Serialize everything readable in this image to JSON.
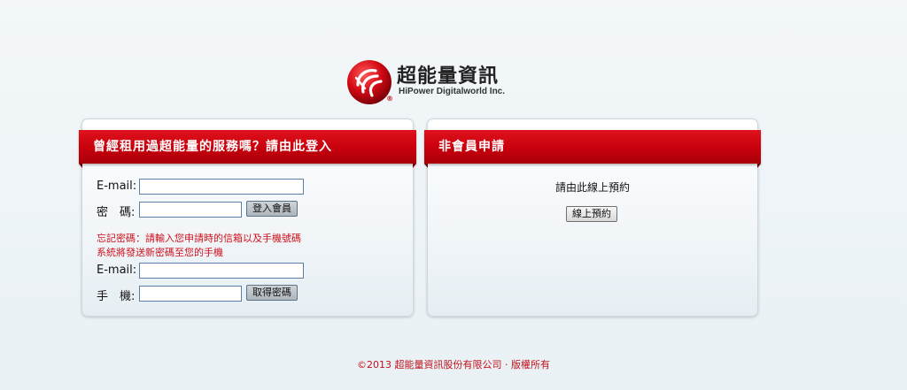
{
  "logo": {
    "name_cn": "超能量資訊",
    "name_en": "HiPower Digitalworld Inc.",
    "reg_mark": "®"
  },
  "login_panel": {
    "title": "曾經租用過超能量的服務嗎？請由此登入",
    "email_label": "E-mail:",
    "password_label": "密　碼:",
    "login_button": "登入會員",
    "forgot_line1": "忘記密碼：請輸入您申請時的信箱以及手機號碼",
    "forgot_line2": "系統將發送新密碼至您的手機",
    "forgot_email_label": "E-mail:",
    "phone_label": "手　機:",
    "get_password_button": "取得密碼"
  },
  "register_panel": {
    "title": "非會員申請",
    "text": "請由此線上預約",
    "button": "線上預約"
  },
  "footer": {
    "text": "©2013 超能量資訊股份有限公司 ‧ 版權所有"
  },
  "colors": {
    "brand_red": "#c7000c",
    "notice_red": "#d0111c"
  }
}
